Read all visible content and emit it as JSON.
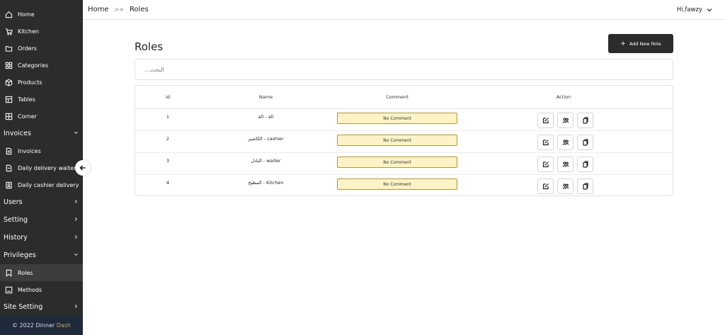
{
  "sidebar": {
    "items": [
      {
        "label": "Home",
        "icon": "home-icon"
      },
      {
        "label": "Kitchen",
        "icon": "cart-icon"
      },
      {
        "label": "Orders",
        "icon": "folder-icon"
      },
      {
        "label": "Categories",
        "icon": "grid-icon"
      },
      {
        "label": "Products",
        "icon": "box-icon"
      },
      {
        "label": "Tables",
        "icon": "table-icon"
      },
      {
        "label": "Corner",
        "icon": "table-icon"
      }
    ],
    "groups": {
      "invoices": "Invoices",
      "users": "Users",
      "setting": "Setting",
      "history": "History",
      "privileges": "Privileges",
      "site_setting": "Site Setting"
    },
    "invoices_items": [
      {
        "label": "Invoices"
      },
      {
        "label": "Daily delivery waiter"
      },
      {
        "label": "Daily cashier delivery"
      }
    ],
    "privileges_items": [
      {
        "label": "Roles"
      },
      {
        "label": "Methods"
      }
    ],
    "footer": {
      "prefix": "© 2022 Dinner",
      "brand": "Dash"
    }
  },
  "header": {
    "breadcrumb_home": "Home",
    "breadcrumb_sep": ">>",
    "breadcrumb_current": "Roles",
    "user_greeting": "Hi,fawzy"
  },
  "main": {
    "title": "Roles",
    "add_button": "Add New Role",
    "search_placeholder": "البحث...",
    "columns": {
      "id": "Id",
      "name": "Name",
      "comment": "Comment",
      "action": "Action"
    },
    "rows": [
      {
        "id": "1",
        "name": "all - all",
        "comment": "No Comment"
      },
      {
        "id": "2",
        "name": "الكاشير - cashier",
        "comment": "No Comment"
      },
      {
        "id": "3",
        "name": "النادل - waiter",
        "comment": "No Comment"
      },
      {
        "id": "4",
        "name": "المطبخ - Kitchen",
        "comment": "No Comment"
      }
    ]
  }
}
